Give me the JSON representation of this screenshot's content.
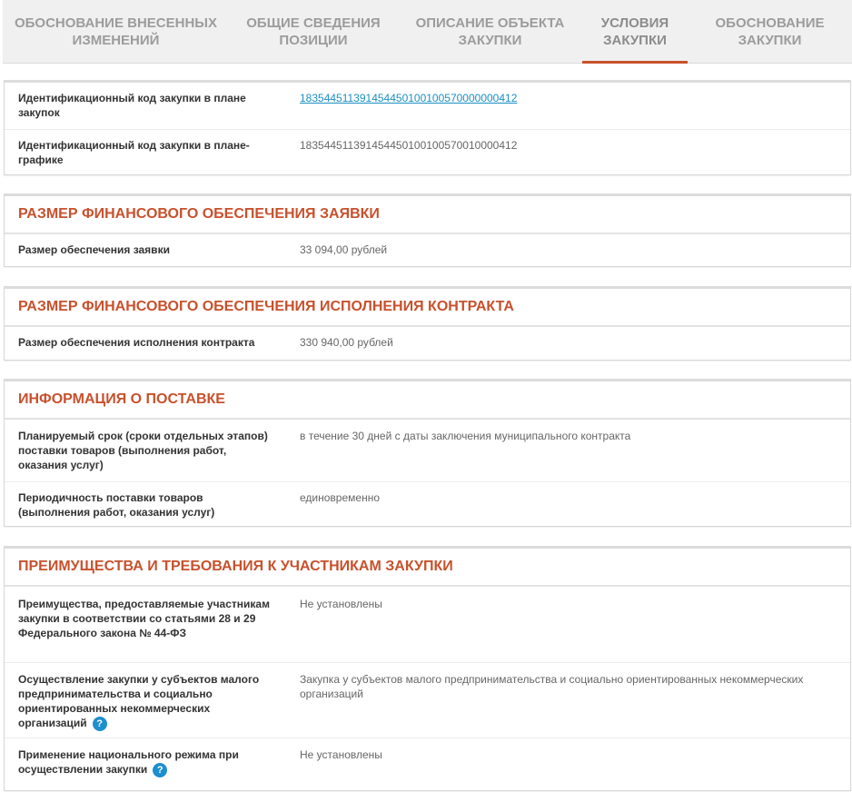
{
  "tabs": [
    {
      "label": "ОБОСНОВАНИЕ ВНЕСЕННЫХ ИЗМЕНЕНИЙ",
      "active": false
    },
    {
      "label": "ОБЩИЕ СВЕДЕНИЯ ПОЗИЦИИ",
      "active": false
    },
    {
      "label": "ОПИСАНИЕ ОБЪЕКТА ЗАКУПКИ",
      "active": false
    },
    {
      "label": "УСЛОВИЯ ЗАКУПКИ",
      "active": true
    },
    {
      "label": "ОБОСНОВАНИЕ ЗАКУПКИ",
      "active": false
    }
  ],
  "ids": {
    "plan_label": "Идентификационный код закупки в плане закупок",
    "plan_value": "183544511391454450100100570000000412",
    "schedule_label": "Идентификационный код закупки в плане-графике",
    "schedule_value": "183544511391454450100100570010000412"
  },
  "bid_security": {
    "title": "РАЗМЕР ФИНАНСОВОГО ОБЕСПЕЧЕНИЯ ЗАЯВКИ",
    "label": "Размер обеспечения заявки",
    "value": "33 094,00 рублей"
  },
  "contract_security": {
    "title": "РАЗМЕР ФИНАНСОВОГО ОБЕСПЕЧЕНИЯ ИСПОЛНЕНИЯ КОНТРАКТА",
    "label": "Размер обеспечения исполнения контракта",
    "value": "330 940,00 рублей"
  },
  "delivery": {
    "title": "ИНФОРМАЦИЯ О ПОСТАВКЕ",
    "term_label": "Планируемый срок (сроки отдельных этапов) поставки товаров (выполнения работ, оказания услуг)",
    "term_value": "в течение 30 дней с даты заключения муниципального контракта",
    "period_label": "Периодичность поставки товаров (выполнения работ, оказания услуг)",
    "period_value": "единовременно"
  },
  "benefits": {
    "title": "ПРЕИМУЩЕСТВА И ТРЕБОВАНИЯ К УЧАСТНИКАМ ЗАКУПКИ",
    "adv_label": "Преимущества, предоставляемые участникам закупки в соответствии со статьями 28 и 29 Федерального закона № 44-ФЗ",
    "adv_value": "Не установлены",
    "smp_label": "Осуществление закупки у субъектов малого предпринимательства и социально ориентированных некоммерческих организаций",
    "smp_value": "Закупка у субъектов малого предпринимательства и социально ориентированных некоммерческих организаций",
    "national_label": "Применение национального режима при осуществлении закупки",
    "national_value": "Не установлены",
    "help_glyph": "?"
  },
  "colors": {
    "accent": "#c8512c",
    "link": "#1a8fc2",
    "help": "#1d8fcf"
  }
}
